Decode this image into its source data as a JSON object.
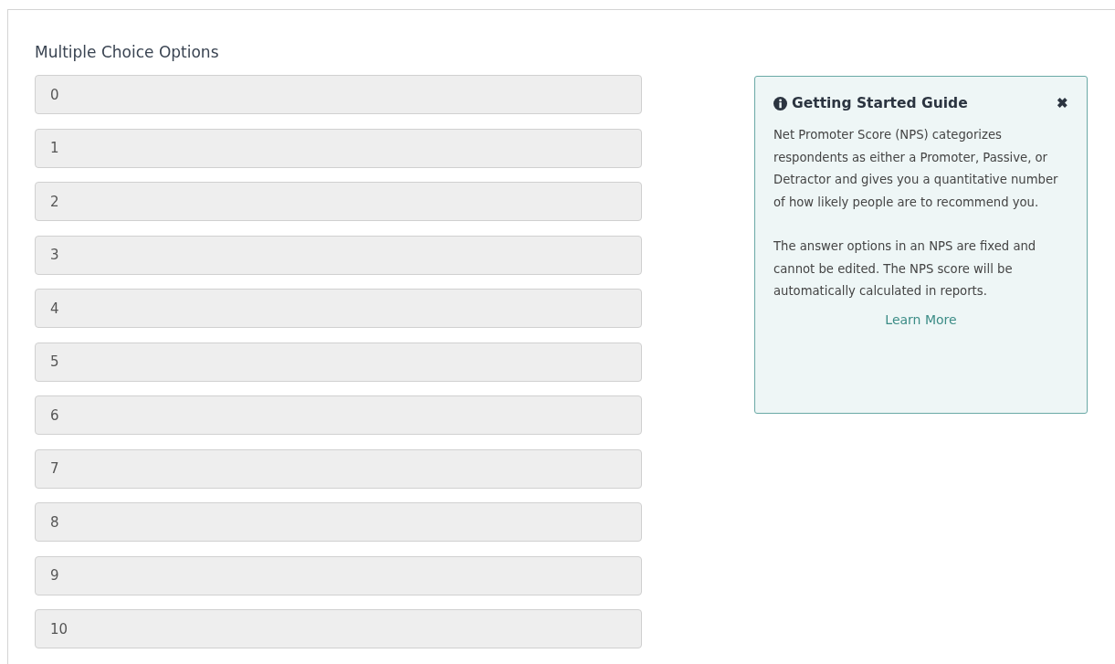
{
  "options_label": "Multiple Choice Options",
  "options": [
    {
      "value": "0",
      "disabled": true
    },
    {
      "value": "1",
      "disabled": true
    },
    {
      "value": "2",
      "disabled": true
    },
    {
      "value": "3",
      "disabled": true
    },
    {
      "value": "4",
      "disabled": true
    },
    {
      "value": "5",
      "disabled": true
    },
    {
      "value": "6",
      "disabled": true
    },
    {
      "value": "7",
      "disabled": true
    },
    {
      "value": "8",
      "disabled": true
    },
    {
      "value": "9",
      "disabled": true
    },
    {
      "value": "10",
      "disabled": true
    }
  ],
  "guide": {
    "title": "Getting Started Guide",
    "close": "✖",
    "paragraphs": [
      "Net Promoter Score (NPS) categorizes respondents as either a Promoter, Passive, or Detractor and gives you a quantitative number of how likely people are to recommend you.",
      "The answer options in an NPS are fixed and cannot be edited. The NPS score will be automatically calculated in reports."
    ],
    "link": "Learn More"
  }
}
